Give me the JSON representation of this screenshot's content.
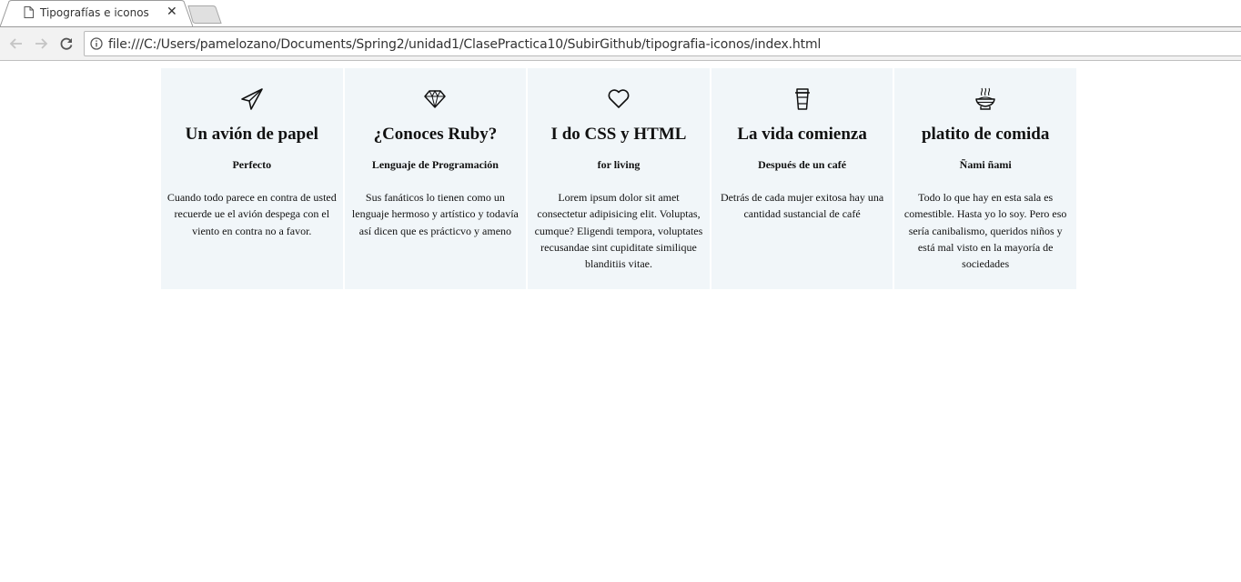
{
  "browser": {
    "tab": {
      "title": "Tipografías e iconos",
      "close_glyph": "✕",
      "icon": "page-icon"
    },
    "nav": {
      "back_icon": "back-arrow-icon",
      "forward_icon": "forward-arrow-icon",
      "reload_icon": "reload-icon"
    },
    "address_bar": {
      "url": "file:///C:/Users/pamelozano/Documents/Spring2/unidad1/ClasePractica10/SubirGithub/tipografia-iconos/index.html",
      "icon": "info-icon"
    }
  },
  "page": {
    "card_background": "#f1f6f9",
    "cards": [
      {
        "icon": "paper-plane-icon",
        "title": "Un avión de papel",
        "subtitle": "Perfecto",
        "text": "Cuando todo parece en contra de usted recuerde ue el avión despega con el viento en contra no a favor."
      },
      {
        "icon": "diamond-icon",
        "title": "¿Conoces Ruby?",
        "subtitle": "Lenguaje de Programación",
        "text": "Sus fanáticos lo tienen como un lenguaje hermoso y artístico y todavía así dicen que es prácticvo y ameno"
      },
      {
        "icon": "heart-icon",
        "title": "I do CSS y HTML",
        "subtitle": "for living",
        "text": "Lorem ipsum dolor sit amet consectetur adipisicing elit. Voluptas, cumque? Eligendi tempora, voluptates recusandae sint cupiditate similique blanditiis vitae."
      },
      {
        "icon": "coffee-cup-icon",
        "title": "La vida comienza",
        "subtitle": "Después de un café",
        "text": "Detrás de cada mujer exitosa hay una cantidad sustancial de café"
      },
      {
        "icon": "food-bowl-icon",
        "title": "platito de comida",
        "subtitle": "Ñami ñami",
        "text": "Todo lo que hay en esta sala es comestible. Hasta yo lo soy. Pero eso sería canibalismo, queridos niños y está mal visto en la mayoría de sociedades"
      }
    ]
  }
}
